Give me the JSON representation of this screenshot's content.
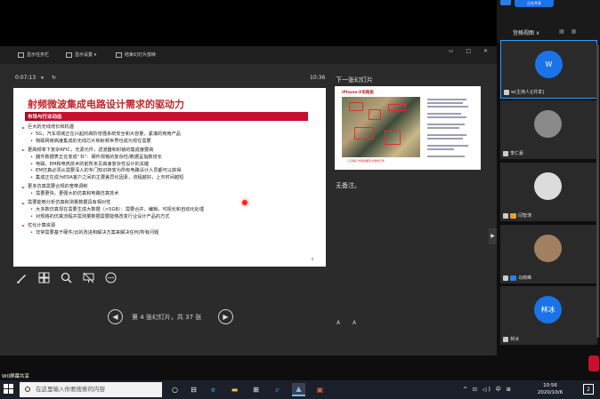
{
  "presenter": {
    "toolbar": {
      "show_taskbar": "显示任务栏",
      "display_settings": "显示设置 ▾",
      "end_show": "结束幻灯片放映"
    },
    "window_controls": "▭ □ ✕",
    "timer": "0:07:13",
    "pause_icon": "pause-icon",
    "reset_icon": "reset-icon",
    "clock": "10:36",
    "next_label": "下一张幻灯片",
    "notes": "无备注。",
    "font_controls": "A A",
    "nav": {
      "prev_icon": "chevron-left-icon",
      "next_icon": "chevron-right-icon",
      "text": "第 4 张幻灯片，共 37 张"
    },
    "tools": [
      "pen-icon",
      "grid-icon",
      "zoom-icon",
      "screen-icon",
      "more-icon"
    ]
  },
  "slide": {
    "title": "射频微波集成电路设计需求的驱动力",
    "subtitle": "市场与行业动态",
    "page": "4",
    "bullets": [
      {
        "level": 1,
        "text": "巨大的无线增长和机遇"
      },
      {
        "level": 2,
        "text": "5G，汽车领域正在兴起的高阶增强系统安全和大容量，紧凑的商用产品"
      },
      {
        "level": 2,
        "text": "物联网使高度集成的无线芯片和射频世界也成为现在需要"
      },
      {
        "level": 1,
        "text": "更高频率下复杂RFIC，无源元件，滤波器和封装的集成度要高"
      },
      {
        "level": 2,
        "text": "器件数据表正在变成“书”：硬件规格的复杂性/数据呈指数增长"
      },
      {
        "level": 2,
        "text": "电磁，EM和电热技术的前所未见高速复杂性设计的关键"
      },
      {
        "level": 2,
        "text": "EM仿真必须从需要深入的专门知识转变为所有电路设计人员都可以获得"
      },
      {
        "level": 2,
        "text": "集成正在成为EDA客户之间的主要差异化因素，流程越好，上市时间越短"
      },
      {
        "level": 1,
        "text": "更多仿真需要合规的宽带调制"
      },
      {
        "level": 2,
        "text": "需要更快，更强大的仿真和电路仿真技术"
      },
      {
        "level": 1,
        "text": "需要能够分析仿真和测量数据具有相对性"
      },
      {
        "level": 2,
        "text": "大多数仿真现在需要生成大数据（>5GB）：需要合并，编辑，可视化和自动化处理"
      },
      {
        "level": 2,
        "text": "对规格的仿真流程并需测量数据需要能够改变行业设计产品的方式"
      },
      {
        "level": 1,
        "text": "优化计算资源"
      },
      {
        "level": 2,
        "text": "非常需要基于硬件/云的改进和解决方案来解决任何/所有问题"
      }
    ]
  },
  "next_slide": {
    "title": "iPhone-X电路板",
    "caption": "几乎每平方毫米都有大量的元件"
  },
  "meeting": {
    "header": "宫格视图 ∨",
    "share_badge": "正在共享",
    "screen_share_label": "W0屏幕共享",
    "participants": [
      {
        "avatar_text": "W",
        "name": "w(主持人)[共享]",
        "avatar_color": "#1a73e8",
        "active": true
      },
      {
        "avatar_text": "",
        "name": "李仁豪",
        "avatar_color": "#8a8a8a",
        "active": false
      },
      {
        "avatar_text": "",
        "name": "闫智涛",
        "avatar_color": "#dcdcdc",
        "active": false
      },
      {
        "avatar_text": "",
        "name": "马晓峰",
        "avatar_color": "#a08060",
        "active": false
      },
      {
        "avatar_text": "林冰",
        "name": "林冰",
        "avatar_color": "#1a73e8",
        "active": false
      }
    ]
  },
  "taskbar": {
    "search_placeholder": "在这里输入你要搜索的内容",
    "time": "10:56",
    "date": "2020/10/6",
    "tray": "^ ⊡ ◁) 中 ⊞",
    "notification_count": "2",
    "apps": [
      "task-view-icon",
      "edge-icon",
      "file-explorer-icon",
      "store-icon",
      "ie-icon",
      "meeting-app-icon",
      "powerpoint-icon"
    ]
  },
  "colors": {
    "accent_red": "#c8102e",
    "brand_blue": "#1a73e8"
  }
}
